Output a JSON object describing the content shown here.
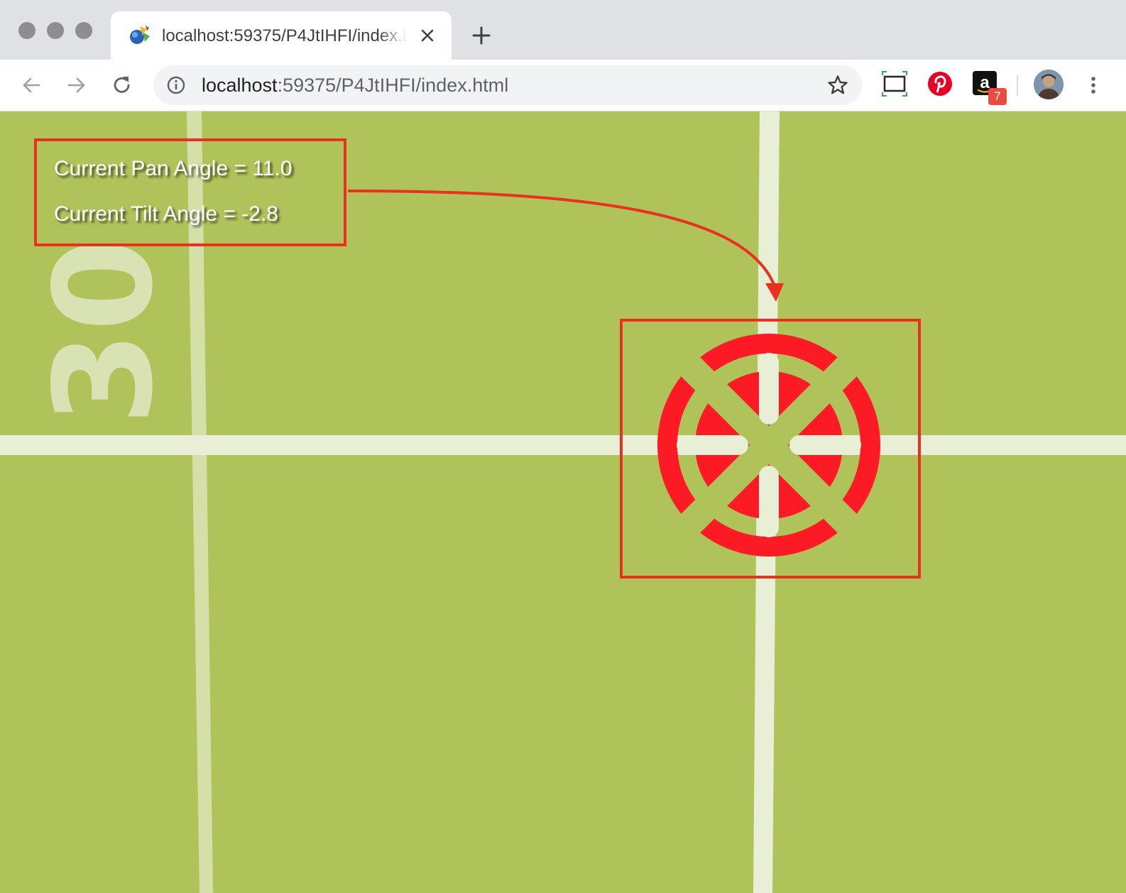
{
  "browser": {
    "tab": {
      "title": "localhost:59375/P4JtIHFI/index.html",
      "favicon": "sphere-favicon"
    },
    "address_bar": {
      "host": "localhost",
      "path": ":59375/P4JtIHFI/index.html"
    },
    "icons": {
      "back": "arrow-left-icon",
      "forward": "arrow-right-icon",
      "reload": "reload-icon",
      "info": "info-icon",
      "bookmark": "star-icon",
      "close_tab": "close-icon",
      "new_tab": "plus-icon",
      "screen_ext": "screen-capture-icon",
      "pinterest_ext": "pinterest-icon",
      "amazon_ext": "amazon-icon",
      "menu": "vertical-dots-icon"
    },
    "amazon_badge": "7"
  },
  "page": {
    "field_number": "30",
    "pan_text": "Current Pan Angle = 11.0",
    "tilt_text": "Current Tilt Angle = -2.8",
    "colors": {
      "field": "#b0c35b",
      "field_lines": "#e9efd6",
      "crosshair": "#fc1b24",
      "annotation": "#e8321f"
    },
    "crosshair_icon": "crosshair-target-icon"
  }
}
